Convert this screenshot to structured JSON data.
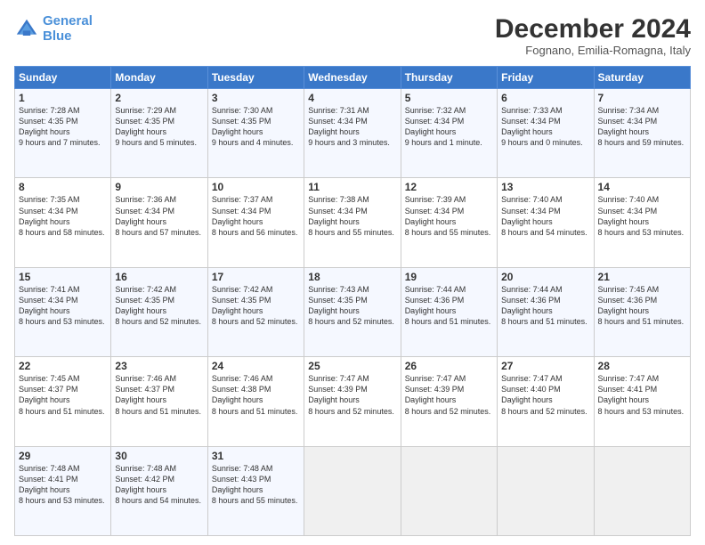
{
  "header": {
    "logo_line1": "General",
    "logo_line2": "Blue",
    "month": "December 2024",
    "location": "Fognano, Emilia-Romagna, Italy"
  },
  "weekdays": [
    "Sunday",
    "Monday",
    "Tuesday",
    "Wednesday",
    "Thursday",
    "Friday",
    "Saturday"
  ],
  "weeks": [
    [
      {
        "day": "1",
        "sunrise": "7:28 AM",
        "sunset": "4:35 PM",
        "daylight": "9 hours and 7 minutes."
      },
      {
        "day": "2",
        "sunrise": "7:29 AM",
        "sunset": "4:35 PM",
        "daylight": "9 hours and 5 minutes."
      },
      {
        "day": "3",
        "sunrise": "7:30 AM",
        "sunset": "4:35 PM",
        "daylight": "9 hours and 4 minutes."
      },
      {
        "day": "4",
        "sunrise": "7:31 AM",
        "sunset": "4:34 PM",
        "daylight": "9 hours and 3 minutes."
      },
      {
        "day": "5",
        "sunrise": "7:32 AM",
        "sunset": "4:34 PM",
        "daylight": "9 hours and 1 minute."
      },
      {
        "day": "6",
        "sunrise": "7:33 AM",
        "sunset": "4:34 PM",
        "daylight": "9 hours and 0 minutes."
      },
      {
        "day": "7",
        "sunrise": "7:34 AM",
        "sunset": "4:34 PM",
        "daylight": "8 hours and 59 minutes."
      }
    ],
    [
      {
        "day": "8",
        "sunrise": "7:35 AM",
        "sunset": "4:34 PM",
        "daylight": "8 hours and 58 minutes."
      },
      {
        "day": "9",
        "sunrise": "7:36 AM",
        "sunset": "4:34 PM",
        "daylight": "8 hours and 57 minutes."
      },
      {
        "day": "10",
        "sunrise": "7:37 AM",
        "sunset": "4:34 PM",
        "daylight": "8 hours and 56 minutes."
      },
      {
        "day": "11",
        "sunrise": "7:38 AM",
        "sunset": "4:34 PM",
        "daylight": "8 hours and 55 minutes."
      },
      {
        "day": "12",
        "sunrise": "7:39 AM",
        "sunset": "4:34 PM",
        "daylight": "8 hours and 55 minutes."
      },
      {
        "day": "13",
        "sunrise": "7:40 AM",
        "sunset": "4:34 PM",
        "daylight": "8 hours and 54 minutes."
      },
      {
        "day": "14",
        "sunrise": "7:40 AM",
        "sunset": "4:34 PM",
        "daylight": "8 hours and 53 minutes."
      }
    ],
    [
      {
        "day": "15",
        "sunrise": "7:41 AM",
        "sunset": "4:34 PM",
        "daylight": "8 hours and 53 minutes."
      },
      {
        "day": "16",
        "sunrise": "7:42 AM",
        "sunset": "4:35 PM",
        "daylight": "8 hours and 52 minutes."
      },
      {
        "day": "17",
        "sunrise": "7:42 AM",
        "sunset": "4:35 PM",
        "daylight": "8 hours and 52 minutes."
      },
      {
        "day": "18",
        "sunrise": "7:43 AM",
        "sunset": "4:35 PM",
        "daylight": "8 hours and 52 minutes."
      },
      {
        "day": "19",
        "sunrise": "7:44 AM",
        "sunset": "4:36 PM",
        "daylight": "8 hours and 51 minutes."
      },
      {
        "day": "20",
        "sunrise": "7:44 AM",
        "sunset": "4:36 PM",
        "daylight": "8 hours and 51 minutes."
      },
      {
        "day": "21",
        "sunrise": "7:45 AM",
        "sunset": "4:36 PM",
        "daylight": "8 hours and 51 minutes."
      }
    ],
    [
      {
        "day": "22",
        "sunrise": "7:45 AM",
        "sunset": "4:37 PM",
        "daylight": "8 hours and 51 minutes."
      },
      {
        "day": "23",
        "sunrise": "7:46 AM",
        "sunset": "4:37 PM",
        "daylight": "8 hours and 51 minutes."
      },
      {
        "day": "24",
        "sunrise": "7:46 AM",
        "sunset": "4:38 PM",
        "daylight": "8 hours and 51 minutes."
      },
      {
        "day": "25",
        "sunrise": "7:47 AM",
        "sunset": "4:39 PM",
        "daylight": "8 hours and 52 minutes."
      },
      {
        "day": "26",
        "sunrise": "7:47 AM",
        "sunset": "4:39 PM",
        "daylight": "8 hours and 52 minutes."
      },
      {
        "day": "27",
        "sunrise": "7:47 AM",
        "sunset": "4:40 PM",
        "daylight": "8 hours and 52 minutes."
      },
      {
        "day": "28",
        "sunrise": "7:47 AM",
        "sunset": "4:41 PM",
        "daylight": "8 hours and 53 minutes."
      }
    ],
    [
      {
        "day": "29",
        "sunrise": "7:48 AM",
        "sunset": "4:41 PM",
        "daylight": "8 hours and 53 minutes."
      },
      {
        "day": "30",
        "sunrise": "7:48 AM",
        "sunset": "4:42 PM",
        "daylight": "8 hours and 54 minutes."
      },
      {
        "day": "31",
        "sunrise": "7:48 AM",
        "sunset": "4:43 PM",
        "daylight": "8 hours and 55 minutes."
      },
      null,
      null,
      null,
      null
    ]
  ]
}
